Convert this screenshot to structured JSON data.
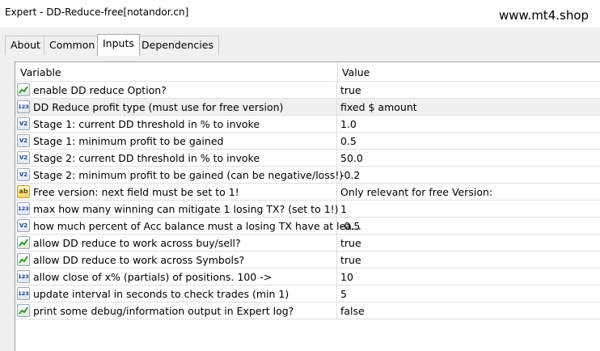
{
  "window": {
    "title": "Expert - DD-Reduce-free[notandor.cn]",
    "watermark": "www.mt4.shop"
  },
  "tabs": [
    {
      "label": "About",
      "active": false
    },
    {
      "label": "Common",
      "active": false
    },
    {
      "label": "Inputs",
      "active": true
    },
    {
      "label": "Dependencies",
      "active": false
    }
  ],
  "table": {
    "headers": {
      "variable": "Variable",
      "value": "Value"
    },
    "rows": [
      {
        "icon": "bool-icon",
        "icon_text": "",
        "variable": "enable DD reduce Option?",
        "value": "true"
      },
      {
        "icon": "int-icon",
        "icon_text": "123",
        "variable": "DD Reduce profit type (must use for free version)",
        "value": "fixed $ amount"
      },
      {
        "icon": "double-icon",
        "icon_text": "V2",
        "variable": "Stage 1: current DD threshold in % to invoke",
        "value": "1.0"
      },
      {
        "icon": "double-icon",
        "icon_text": "V2",
        "variable": "Stage 1: minimum profit to be gained",
        "value": "0.5"
      },
      {
        "icon": "double-icon",
        "icon_text": "V2",
        "variable": "Stage 2: current DD threshold in % to invoke",
        "value": "50.0"
      },
      {
        "icon": "double-icon",
        "icon_text": "V2",
        "variable": "Stage 2: minimum profit to be gained (can be negative/loss!)",
        "value": "-0.2"
      },
      {
        "icon": "string-icon",
        "icon_text": "ab",
        "variable": "Free version: next field must be set to 1!",
        "value": "Only relevant for free Version:"
      },
      {
        "icon": "int-icon",
        "icon_text": "123",
        "variable": "max how many winning can mitigate 1 losing TX? (set to 1!)",
        "value": "1"
      },
      {
        "icon": "double-icon",
        "icon_text": "V2",
        "variable": "how much percent of Acc balance must a losing TX have at lea...",
        "value": "-0.5"
      },
      {
        "icon": "bool-icon",
        "icon_text": "",
        "variable": "allow DD reduce to work across buy/sell?",
        "value": "true"
      },
      {
        "icon": "bool-icon",
        "icon_text": "",
        "variable": "allow DD reduce to work across Symbols?",
        "value": "true"
      },
      {
        "icon": "int-icon",
        "icon_text": "123",
        "variable": "allow close of x% (partials) of positions. 100 ->",
        "value": "10"
      },
      {
        "icon": "int-icon",
        "icon_text": "123",
        "variable": "update interval in seconds to check trades (min 1)",
        "value": "5"
      },
      {
        "icon": "bool-icon",
        "icon_text": "",
        "variable": "print some debug/information output in Expert log?",
        "value": "false"
      }
    ]
  }
}
